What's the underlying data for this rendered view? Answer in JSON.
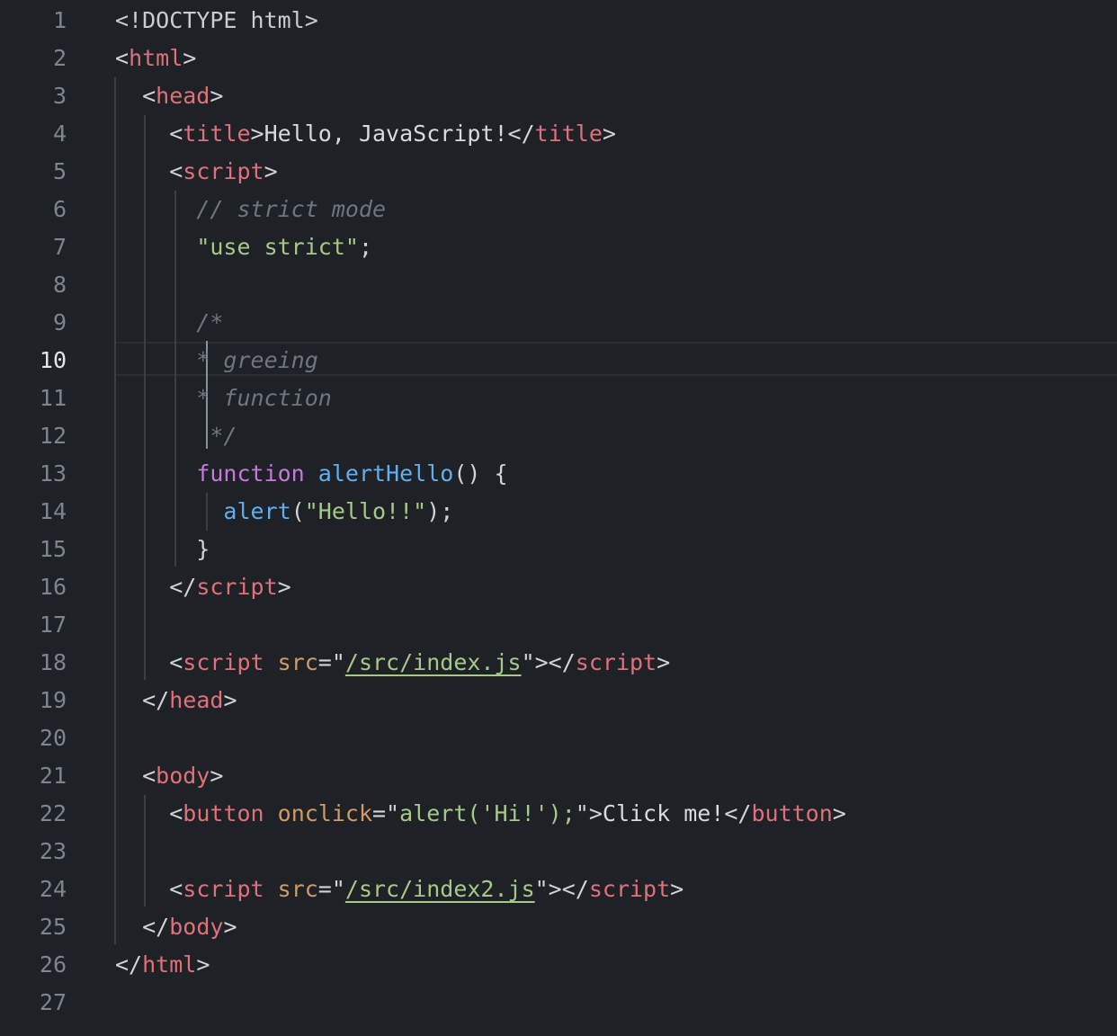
{
  "editor": {
    "active_line": 10,
    "line_numbers": [
      "1",
      "2",
      "3",
      "4",
      "5",
      "6",
      "7",
      "8",
      "9",
      "10",
      "11",
      "12",
      "13",
      "14",
      "15",
      "16",
      "17",
      "18",
      "19",
      "20",
      "21",
      "22",
      "23",
      "24",
      "25",
      "26",
      "27"
    ],
    "lines": [
      {
        "tokens": [
          [
            "t-doctype",
            "<!DOCTYPE html>"
          ]
        ]
      },
      {
        "tokens": [
          [
            "t-punct",
            "<"
          ],
          [
            "t-tag",
            "html"
          ],
          [
            "t-punct",
            ">"
          ]
        ]
      },
      {
        "tokens": [
          [
            "t-punct",
            "  <"
          ],
          [
            "t-tag",
            "head"
          ],
          [
            "t-punct",
            ">"
          ]
        ]
      },
      {
        "tokens": [
          [
            "t-punct",
            "    <"
          ],
          [
            "t-tag",
            "title"
          ],
          [
            "t-punct",
            ">"
          ],
          [
            "t-text",
            "Hello, JavaScript!"
          ],
          [
            "t-punct",
            "</"
          ],
          [
            "t-tag",
            "title"
          ],
          [
            "t-punct",
            ">"
          ]
        ]
      },
      {
        "tokens": [
          [
            "t-punct",
            "    <"
          ],
          [
            "t-tag",
            "script"
          ],
          [
            "t-punct",
            ">"
          ]
        ]
      },
      {
        "tokens": [
          [
            "t-cmt",
            "      // strict mode"
          ]
        ]
      },
      {
        "tokens": [
          [
            "t-text",
            "      "
          ],
          [
            "t-str",
            "\"use strict\""
          ],
          [
            "t-punct",
            ";"
          ]
        ]
      },
      {
        "tokens": [
          [
            "t-text",
            ""
          ]
        ]
      },
      {
        "tokens": [
          [
            "t-cmt",
            "      /*"
          ]
        ]
      },
      {
        "tokens": [
          [
            "t-cmt",
            "      * greeing"
          ]
        ]
      },
      {
        "tokens": [
          [
            "t-cmt",
            "      * function"
          ]
        ]
      },
      {
        "tokens": [
          [
            "t-cmt",
            "       */"
          ]
        ]
      },
      {
        "tokens": [
          [
            "t-text",
            "      "
          ],
          [
            "t-kw",
            "function"
          ],
          [
            "t-text",
            " "
          ],
          [
            "t-fn",
            "alertHello"
          ],
          [
            "t-punct",
            "() {"
          ]
        ]
      },
      {
        "tokens": [
          [
            "t-text",
            "        "
          ],
          [
            "t-fn",
            "alert"
          ],
          [
            "t-punct",
            "("
          ],
          [
            "t-str",
            "\"Hello!!\""
          ],
          [
            "t-punct",
            ");"
          ]
        ]
      },
      {
        "tokens": [
          [
            "t-punct",
            "      }"
          ]
        ]
      },
      {
        "tokens": [
          [
            "t-punct",
            "    </"
          ],
          [
            "t-tag",
            "script"
          ],
          [
            "t-punct",
            ">"
          ]
        ]
      },
      {
        "tokens": [
          [
            "t-text",
            ""
          ]
        ]
      },
      {
        "tokens": [
          [
            "t-punct",
            "    <"
          ],
          [
            "t-tag",
            "script"
          ],
          [
            "t-text",
            " "
          ],
          [
            "t-attr",
            "src"
          ],
          [
            "t-punct",
            "=\""
          ],
          [
            "t-link",
            "/src/index.js"
          ],
          [
            "t-punct",
            "\"></"
          ],
          [
            "t-tag",
            "script"
          ],
          [
            "t-punct",
            ">"
          ]
        ]
      },
      {
        "tokens": [
          [
            "t-punct",
            "  </"
          ],
          [
            "t-tag",
            "head"
          ],
          [
            "t-punct",
            ">"
          ]
        ]
      },
      {
        "tokens": [
          [
            "t-text",
            ""
          ]
        ]
      },
      {
        "tokens": [
          [
            "t-punct",
            "  <"
          ],
          [
            "t-tag",
            "body"
          ],
          [
            "t-punct",
            ">"
          ]
        ]
      },
      {
        "tokens": [
          [
            "t-punct",
            "    <"
          ],
          [
            "t-tag",
            "button"
          ],
          [
            "t-text",
            " "
          ],
          [
            "t-attr",
            "onclick"
          ],
          [
            "t-punct",
            "=\""
          ],
          [
            "t-str",
            "alert('Hi!');"
          ],
          [
            "t-punct",
            "\">"
          ],
          [
            "t-text",
            "Click me!"
          ],
          [
            "t-punct",
            "</"
          ],
          [
            "t-tag",
            "button"
          ],
          [
            "t-punct",
            ">"
          ]
        ]
      },
      {
        "tokens": [
          [
            "t-text",
            ""
          ]
        ]
      },
      {
        "tokens": [
          [
            "t-punct",
            "    <"
          ],
          [
            "t-tag",
            "script"
          ],
          [
            "t-text",
            " "
          ],
          [
            "t-attr",
            "src"
          ],
          [
            "t-punct",
            "=\""
          ],
          [
            "t-link",
            "/src/index2.js"
          ],
          [
            "t-punct",
            "\"></"
          ],
          [
            "t-tag",
            "script"
          ],
          [
            "t-punct",
            ">"
          ]
        ]
      },
      {
        "tokens": [
          [
            "t-punct",
            "  </"
          ],
          [
            "t-tag",
            "body"
          ],
          [
            "t-punct",
            ">"
          ]
        ]
      },
      {
        "tokens": [
          [
            "t-punct",
            "</"
          ],
          [
            "t-tag",
            "html"
          ],
          [
            "t-punct",
            ">"
          ]
        ]
      },
      {
        "tokens": [
          [
            "t-text",
            ""
          ]
        ]
      }
    ]
  },
  "colors": {
    "background": "#1e2125",
    "tag": "#e0707a",
    "attribute": "#d19a66",
    "string": "#a6c98a",
    "comment": "#6e7681",
    "keyword": "#c678dd",
    "function": "#61afef"
  }
}
